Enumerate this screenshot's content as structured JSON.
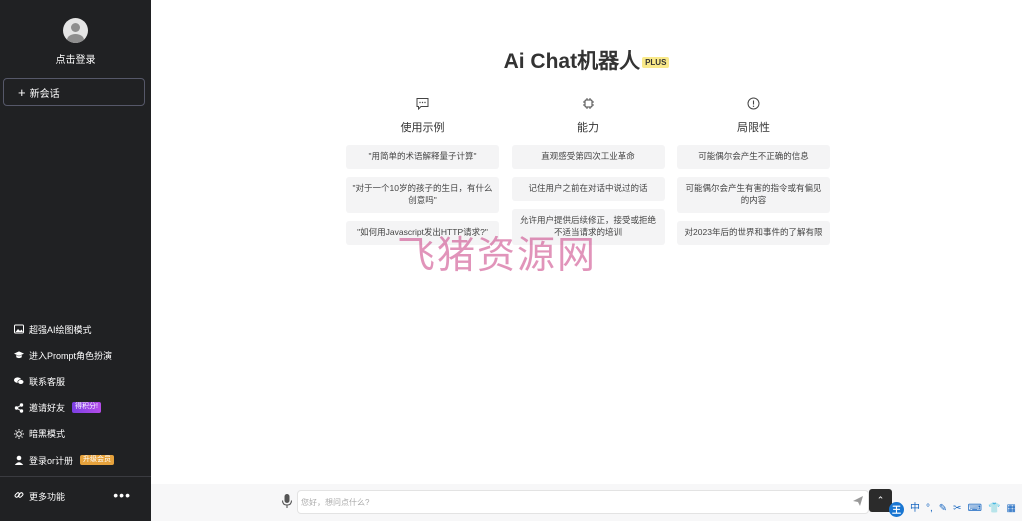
{
  "sidebar": {
    "login_label": "点击登录",
    "new_chat_label": "新会话",
    "menu": [
      {
        "label": "超强AI绘图模式",
        "icon": "image-icon"
      },
      {
        "label": "进入Prompt角色扮演",
        "icon": "graduation-cap-icon"
      },
      {
        "label": "联系客服",
        "icon": "chat-bubbles-icon"
      },
      {
        "label": "邀请好友",
        "icon": "share-icon",
        "badge": "得积分!"
      },
      {
        "label": "暗黑模式",
        "icon": "sun-icon"
      },
      {
        "label": "登录or计册",
        "icon": "user-icon",
        "badge": "升级会员"
      }
    ],
    "more_label": "更多功能"
  },
  "main": {
    "title": "Ai Chat机器人",
    "plus_badge": "PLUS",
    "columns": [
      {
        "title": "使用示例",
        "icon": "message-dots-icon",
        "cards": [
          "\"用简单的术语解释量子计算\"",
          "\"对于一个10岁的孩子的生日，有什么创意吗\"",
          "\"如何用Javascript发出HTTP请求?\""
        ]
      },
      {
        "title": "能力",
        "icon": "chip-icon",
        "cards": [
          "直观感受第四次工业革命",
          "记住用户之前在对话中说过的话",
          "允许用户提供后续修正，接受或拒绝不适当请求的培训"
        ]
      },
      {
        "title": "局限性",
        "icon": "warning-circle-icon",
        "cards": [
          "可能偶尔会产生不正确的信息",
          "可能偶尔会产生有害的指令或有偏见的内容",
          "对2023年后的世界和事件的了解有限"
        ]
      }
    ],
    "watermark": "飞猪资源网"
  },
  "input": {
    "placeholder": "您好，想问点什么?"
  },
  "ime": {
    "mode": "中"
  }
}
